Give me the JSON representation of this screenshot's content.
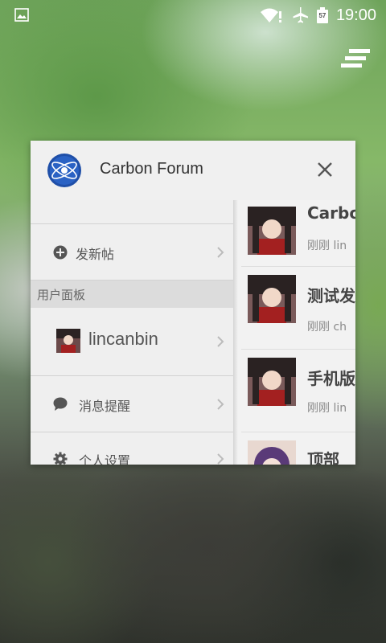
{
  "status_bar": {
    "time": "19:00",
    "battery_level": "57",
    "icons": [
      "image-icon",
      "wifi-warning-icon",
      "airplane-icon",
      "battery-icon"
    ]
  },
  "recents": {
    "icon": "recents-stack-icon"
  },
  "card": {
    "app_title": "Carbon Forum",
    "app_icon": "carbon-forum-logo",
    "close_icon": "close-icon",
    "drawer": {
      "new_post": "发新帖",
      "section_user_panel": "用户面板",
      "username": "lincanbin",
      "messages": "消息提醒",
      "settings": "个人设置"
    },
    "topics": [
      {
        "title": "Carbo",
        "meta": "刚刚  lin"
      },
      {
        "title": "测试发",
        "meta": "刚刚  ch"
      },
      {
        "title": "手机版",
        "meta": "刚刚  lin"
      },
      {
        "title": "顶部",
        "meta": ""
      }
    ]
  },
  "colors": {
    "card_bg": "#fafafa",
    "header_bg": "#f0f0f0",
    "drawer_bg": "#efefef",
    "section_bg": "#dcdcdc",
    "logo_blue": "#1f4fa8"
  }
}
